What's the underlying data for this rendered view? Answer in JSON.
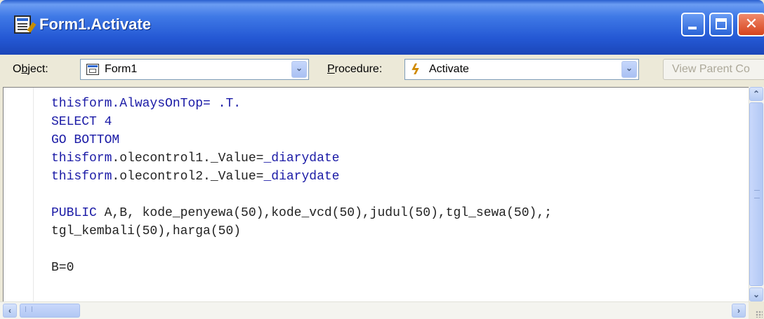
{
  "window": {
    "title": "Form1.Activate",
    "icon": "code-window-icon",
    "controls": {
      "minimize": "minimize-icon",
      "maximize": "maximize-icon",
      "close_glyph": "✕"
    }
  },
  "toolbar": {
    "object_label_prefix": "O",
    "object_label_underlined": "b",
    "object_label_suffix": "ject:",
    "object_value": "Form1",
    "procedure_label_underlined": "P",
    "procedure_label_suffix": "rocedure:",
    "procedure_value": "Activate",
    "view_parent_label": "View Parent Co"
  },
  "code": {
    "lines": [
      [
        {
          "t": "thisform",
          "kw": true
        },
        {
          "t": ".AlwaysOnTop= .T.",
          "kw": true
        }
      ],
      [
        {
          "t": "SELECT 4",
          "kw": true
        }
      ],
      [
        {
          "t": "GO BOTTOM",
          "kw": true
        }
      ],
      [
        {
          "t": "thisform",
          "kw": true
        },
        {
          "t": ".olecontrol1._Value=",
          "kw": false
        },
        {
          "t": "_diarydate",
          "kw": true
        }
      ],
      [
        {
          "t": "thisform",
          "kw": true
        },
        {
          "t": ".olecontrol2._Value=",
          "kw": false
        },
        {
          "t": "_diarydate",
          "kw": true
        }
      ],
      [],
      [
        {
          "t": "PUBLIC",
          "kw": true
        },
        {
          "t": " A,B, kode_penyewa(50),kode_vcd(50),judul(50),tgl_sewa(50),;",
          "kw": false
        }
      ],
      [
        {
          "t": "tgl_kembali(50),harga(50)",
          "kw": false
        }
      ],
      [],
      [
        {
          "t": "B=0",
          "kw": false
        }
      ]
    ]
  },
  "colors": {
    "keyword": "#1a1aa6",
    "text": "#222222",
    "titlebar": "#2458d4"
  }
}
